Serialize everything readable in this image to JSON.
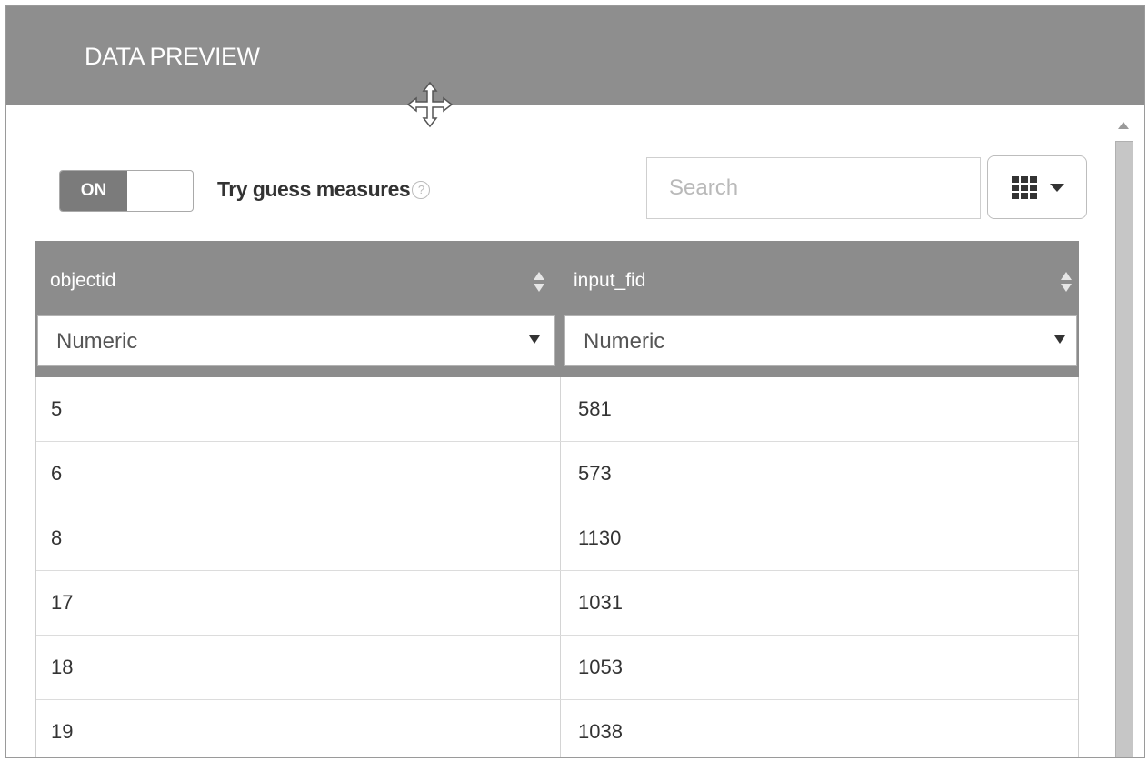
{
  "header": {
    "title": "DATA PREVIEW",
    "move_icon": "move-icon"
  },
  "toolbar": {
    "toggle_label": "ON",
    "guess_label": "Try guess measures",
    "help_icon_glyph": "?",
    "search_placeholder": "Search",
    "columns_icon": "grid-icon"
  },
  "table": {
    "columns": [
      {
        "name": "objectid",
        "type": "Numeric"
      },
      {
        "name": "input_fid",
        "type": "Numeric"
      }
    ],
    "rows": [
      [
        "5",
        "581"
      ],
      [
        "6",
        "573"
      ],
      [
        "8",
        "1130"
      ],
      [
        "17",
        "1031"
      ],
      [
        "18",
        "1053"
      ],
      [
        "19",
        "1038"
      ]
    ]
  },
  "colors": {
    "header_bg": "#8e8e8e",
    "toggle_on_bg": "#7b7b7b"
  }
}
